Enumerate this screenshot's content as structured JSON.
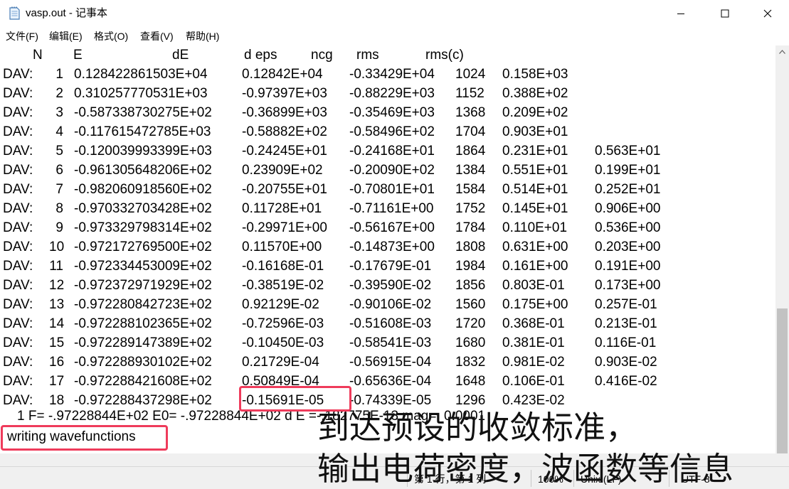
{
  "window": {
    "title": "vasp.out - 记事本",
    "icon": "notepad-icon",
    "controls": {
      "minimize_icon": "minimize-icon",
      "maximize_icon": "maximize-icon",
      "close_icon": "close-icon"
    }
  },
  "menu": [
    "文件(F)",
    "编辑(E)",
    "格式(O)",
    "查看(V)",
    "帮助(H)"
  ],
  "editor": {
    "header": [
      "N",
      "E",
      "dE",
      "d eps",
      "ncg",
      "rms",
      "rms(c)"
    ],
    "rows": [
      [
        "DAV:",
        "1",
        "0.128422861503E+04",
        "0.12842E+04",
        "-0.33429E+04",
        "1024",
        "0.158E+03",
        ""
      ],
      [
        "DAV:",
        "2",
        "0.310257770531E+03",
        "-0.97397E+03",
        "-0.88229E+03",
        "1152",
        "0.388E+02",
        ""
      ],
      [
        "DAV:",
        "3",
        "-0.587338730275E+02",
        "-0.36899E+03",
        "-0.35469E+03",
        "1368",
        "0.209E+02",
        ""
      ],
      [
        "DAV:",
        "4",
        "-0.117615472785E+03",
        "-0.58882E+02",
        "-0.58496E+02",
        "1704",
        "0.903E+01",
        ""
      ],
      [
        "DAV:",
        "5",
        "-0.120039993399E+03",
        "-0.24245E+01",
        "-0.24168E+01",
        "1864",
        "0.231E+01",
        "0.563E+01"
      ],
      [
        "DAV:",
        "6",
        "-0.961305648206E+02",
        "0.23909E+02",
        "-0.20090E+02",
        "1384",
        "0.551E+01",
        "0.199E+01"
      ],
      [
        "DAV:",
        "7",
        "-0.982060918560E+02",
        "-0.20755E+01",
        "-0.70801E+01",
        "1584",
        "0.514E+01",
        "0.252E+01"
      ],
      [
        "DAV:",
        "8",
        "-0.970332703428E+02",
        "0.11728E+01",
        "-0.71161E+00",
        "1752",
        "0.145E+01",
        "0.906E+00"
      ],
      [
        "DAV:",
        "9",
        "-0.973329798314E+02",
        "-0.29971E+00",
        "-0.56167E+00",
        "1784",
        "0.110E+01",
        "0.536E+00"
      ],
      [
        "DAV:",
        "10",
        "-0.972172769500E+02",
        "0.11570E+00",
        "-0.14873E+00",
        "1808",
        "0.631E+00",
        "0.203E+00"
      ],
      [
        "DAV:",
        "11",
        "-0.972334453009E+02",
        "-0.16168E-01",
        "-0.17679E-01",
        "1984",
        "0.161E+00",
        "0.191E+00"
      ],
      [
        "DAV:",
        "12",
        "-0.972372971929E+02",
        "-0.38519E-02",
        "-0.39590E-02",
        "1856",
        "0.803E-01",
        "0.173E+00"
      ],
      [
        "DAV:",
        "13",
        "-0.972280842723E+02",
        "0.92129E-02",
        "-0.90106E-02",
        "1560",
        "0.175E+00",
        "0.257E-01"
      ],
      [
        "DAV:",
        "14",
        "-0.972288102365E+02",
        "-0.72596E-03",
        "-0.51608E-03",
        "1720",
        "0.368E-01",
        "0.213E-01"
      ],
      [
        "DAV:",
        "15",
        "-0.972289147389E+02",
        "-0.10450E-03",
        "-0.58541E-03",
        "1680",
        "0.381E-01",
        "0.116E-01"
      ],
      [
        "DAV:",
        "16",
        "-0.972288930102E+02",
        "0.21729E-04",
        "-0.56915E-04",
        "1832",
        "0.981E-02",
        "0.903E-02"
      ],
      [
        "DAV:",
        "17",
        "-0.972288421608E+02",
        "0.50849E-04",
        "-0.65636E-04",
        "1648",
        "0.106E-01",
        "0.416E-02"
      ],
      [
        "DAV:",
        "18",
        "-0.972288437298E+02",
        "-0.15691E-05",
        "-0.74339E-05",
        "1296",
        "0.423E-02",
        ""
      ]
    ],
    "summary_line": "1 F= -.97228844E+02 E0= -.97228844E+02 d E =-.182775E-13 mag=  0.0001",
    "last_line": "writing wavefunctions"
  },
  "annotations": {
    "line1": "到达预设的收敛标准，",
    "line2": "输出电荷密度，波函数等信息"
  },
  "status": {
    "position": "第 1 行，第 1 列",
    "zoom": "100%",
    "line_ending": "Unix (LF)",
    "encoding": "UTF-8"
  },
  "colors": {
    "highlight": "#ef3b5b"
  }
}
